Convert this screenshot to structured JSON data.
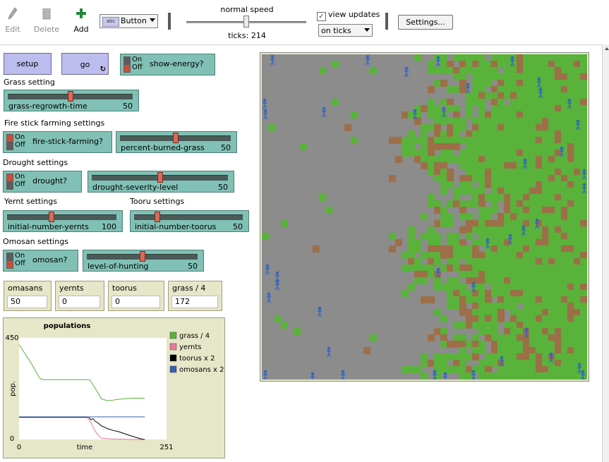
{
  "toolbar": {
    "edit_label": "Edit",
    "delete_label": "Delete",
    "add_label": "Add",
    "widget_type_badge": "abc",
    "widget_type": "Button",
    "speed_label": "normal speed",
    "ticks_text": "ticks: 214",
    "view_updates_label": "view updates",
    "view_updates_checked": "✓",
    "update_mode": "on ticks",
    "settings_label": "Settings..."
  },
  "buttons": {
    "setup": "setup",
    "go": "go",
    "forever_icon": "↻"
  },
  "switches": {
    "show_energy": {
      "on": "On",
      "off": "Off",
      "name": "show-energy?"
    },
    "fire_stick": {
      "on": "On",
      "off": "Off",
      "name": "fire-stick-farming?"
    },
    "drought": {
      "on": "On",
      "off": "Off",
      "name": "drought?"
    },
    "omosan": {
      "on": "On",
      "off": "Off",
      "name": "omosan?"
    }
  },
  "sections": {
    "grass": "Grass setting",
    "fire": "Fire stick farming settings",
    "drought": "Drought settings",
    "yernt": "Yernt settings",
    "tooru": "Tooru settings",
    "omosan": "Omosan settings"
  },
  "sliders": {
    "grass_regrowth": {
      "name": "grass-regrowth-time",
      "value": "50",
      "fraction": 0.5
    },
    "percent_burned": {
      "name": "percent-burned-grass",
      "value": "50",
      "fraction": 0.5
    },
    "drought_severity": {
      "name": "drought-severity-level",
      "value": "50",
      "fraction": 0.5
    },
    "initial_yernts": {
      "name": "initial-number-yernts",
      "value": "100",
      "fraction": 0.4
    },
    "initial_toorus": {
      "name": "initial-number-toorus",
      "value": "50",
      "fraction": 0.2
    },
    "level_hunting": {
      "name": "level-of-hunting",
      "value": "50",
      "fraction": 0.5
    }
  },
  "monitors": [
    {
      "name": "omasans",
      "value": "50"
    },
    {
      "name": "yernts",
      "value": "0"
    },
    {
      "name": "toorus",
      "value": "0"
    },
    {
      "name": "grass / 4",
      "value": "172"
    }
  ],
  "chart_data": {
    "type": "line",
    "title": "populations",
    "xlabel": "time",
    "ylabel": "pop.",
    "xlim": [
      0,
      251
    ],
    "ylim": [
      0,
      450
    ],
    "x_ticks": [
      "0",
      "251"
    ],
    "y_ticks": [
      "0",
      "450"
    ],
    "legend_position": "right",
    "series": [
      {
        "name": "grass / 4",
        "color": "#59b33a",
        "x": [
          0,
          5,
          10,
          15,
          20,
          25,
          30,
          35,
          40,
          120,
          125,
          130,
          140,
          150,
          160,
          170,
          180,
          190,
          200,
          214
        ],
        "y": [
          420,
          400,
          380,
          360,
          340,
          318,
          295,
          272,
          265,
          265,
          245,
          225,
          180,
          172,
          174,
          178,
          180,
          182,
          183,
          182
        ]
      },
      {
        "name": "yernts",
        "color": "#e87a9a",
        "x": [
          0,
          115,
          120,
          125,
          130,
          135,
          140,
          150,
          160,
          170,
          180,
          190,
          200,
          214
        ],
        "y": [
          98,
          98,
          85,
          60,
          35,
          18,
          6,
          3,
          2,
          1,
          1,
          0,
          0,
          0
        ]
      },
      {
        "name": "toorus x 2",
        "color": "#000000",
        "x": [
          0,
          115,
          118,
          122,
          126,
          130,
          135,
          140,
          145,
          150,
          160,
          170,
          180,
          190,
          200,
          210,
          214
        ],
        "y": [
          98,
          98,
          100,
          88,
          92,
          80,
          72,
          60,
          55,
          48,
          40,
          34,
          25,
          16,
          8,
          1,
          0
        ]
      },
      {
        "name": "omosans x 2",
        "color": "#345eb3",
        "x": [
          0,
          214
        ],
        "y": [
          100,
          100
        ]
      }
    ]
  },
  "world": {
    "grass_color": "#59b33a",
    "burned_color": "#9d6e48",
    "bare_color": "#8c8c8c",
    "agent_color": "#2f63c4"
  }
}
